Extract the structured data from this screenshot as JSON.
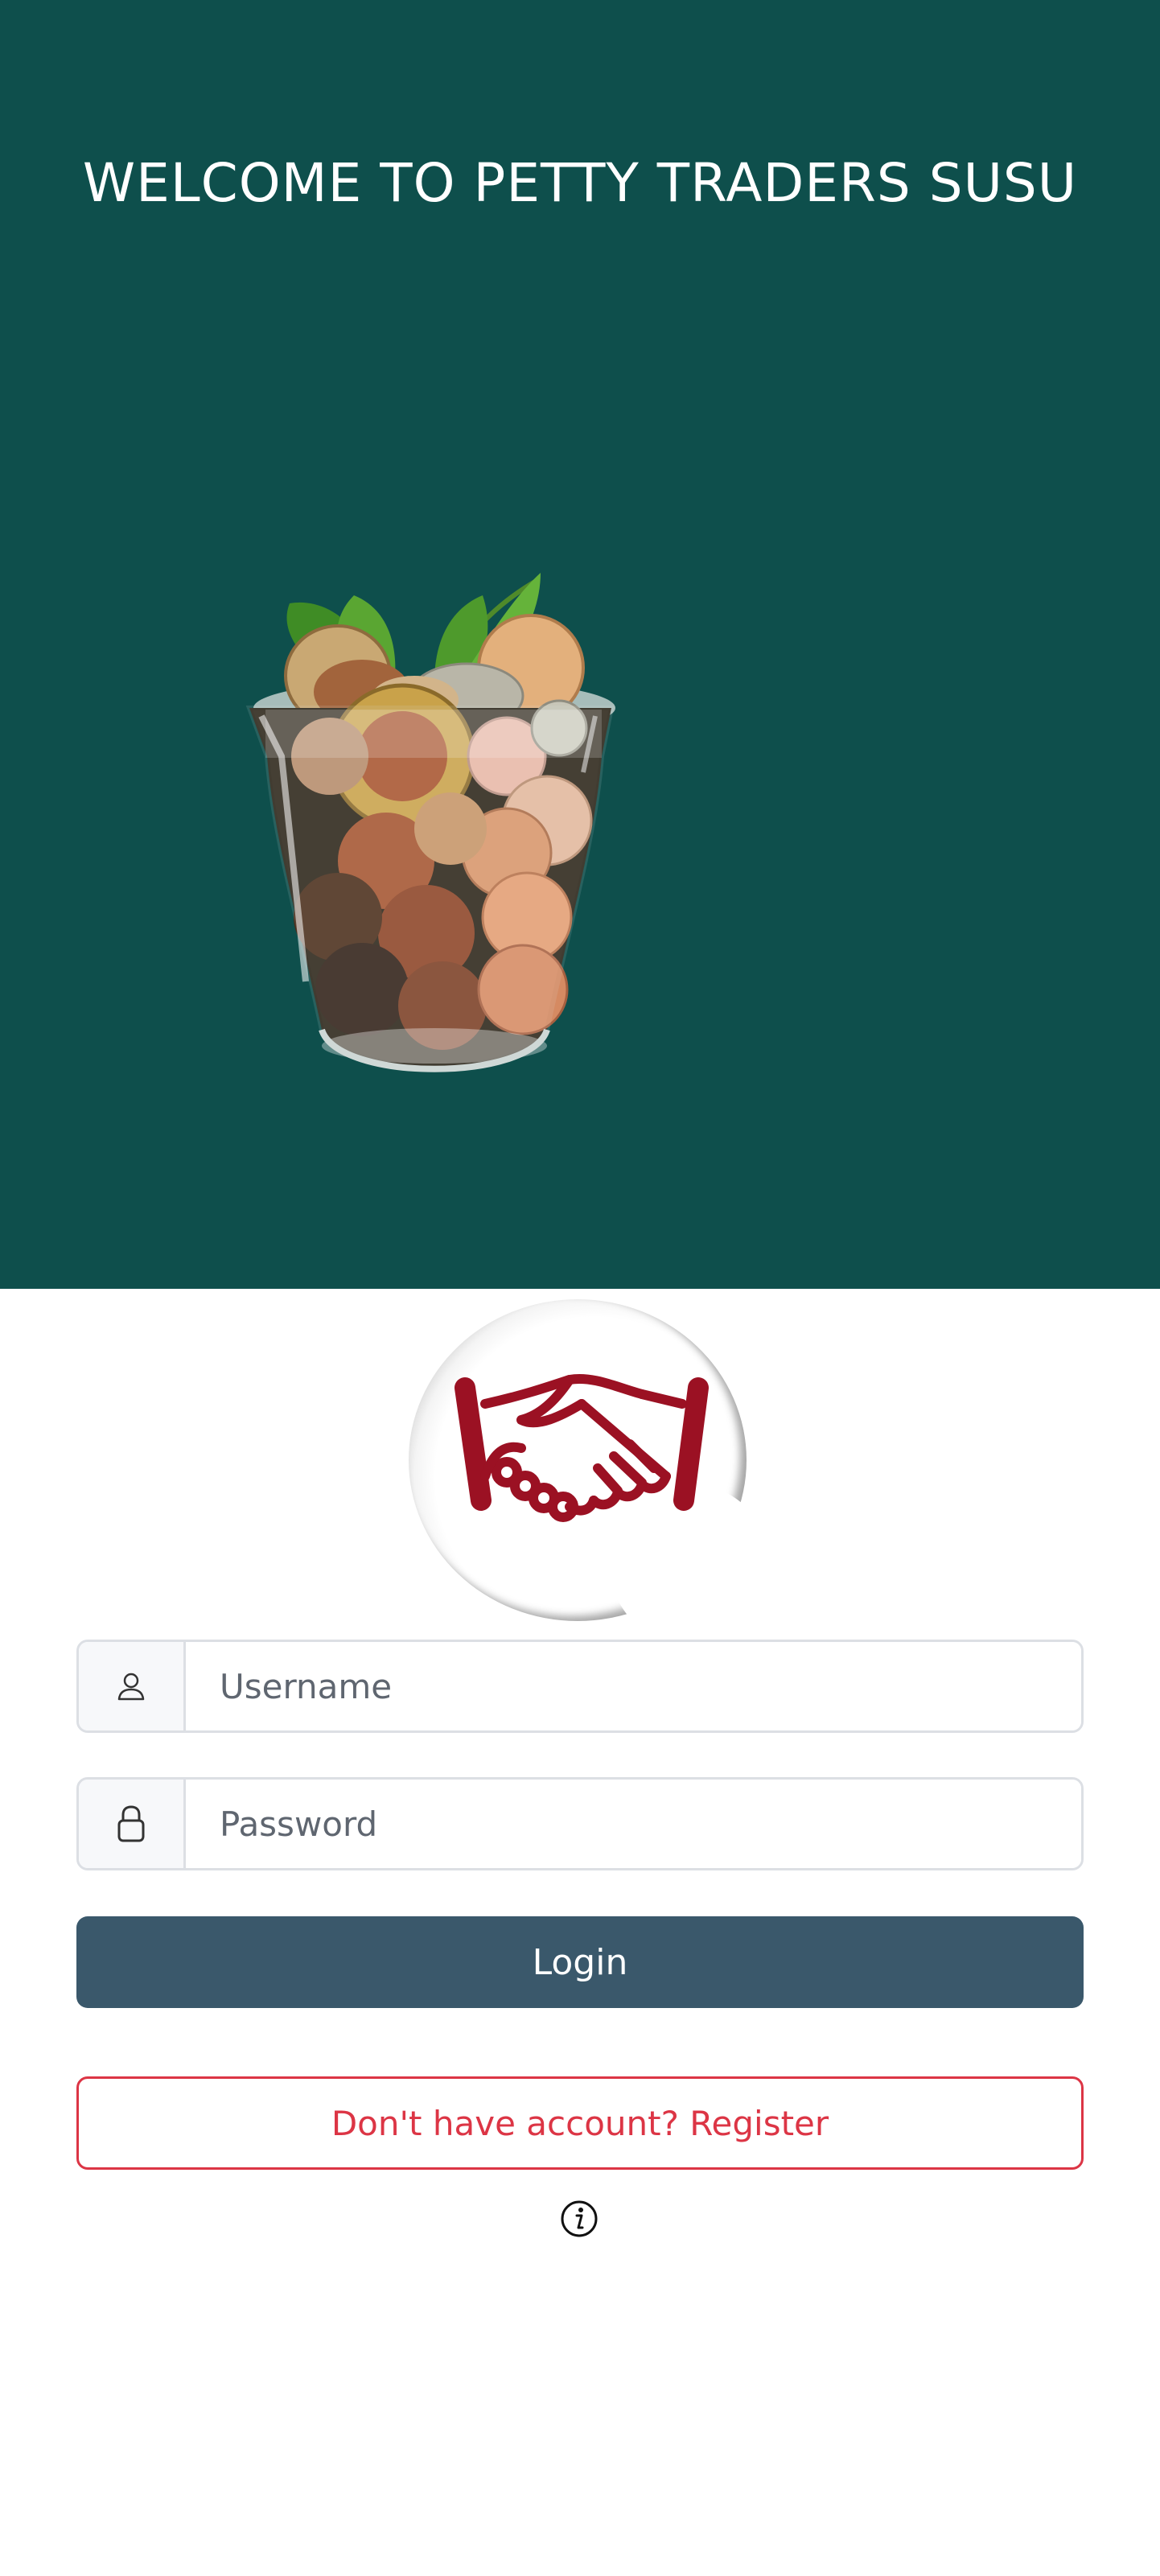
{
  "hero": {
    "title": "WELCOME TO PETTY TRADERS SUSU",
    "background_color": "#0e4f4c",
    "illustration": "plant-growing-from-glass-of-coins"
  },
  "logo": {
    "icon": "handshake-icon",
    "color": "#9b1123"
  },
  "login_form": {
    "username": {
      "icon": "user-icon",
      "placeholder": "Username",
      "value": ""
    },
    "password": {
      "icon": "lock-icon",
      "placeholder": "Password",
      "value": ""
    },
    "login_label": "Login",
    "login_color": "#3a586b",
    "register_label": "Don't have account? Register",
    "register_color": "#dc3545"
  },
  "footer": {
    "info_icon": "info-icon"
  }
}
